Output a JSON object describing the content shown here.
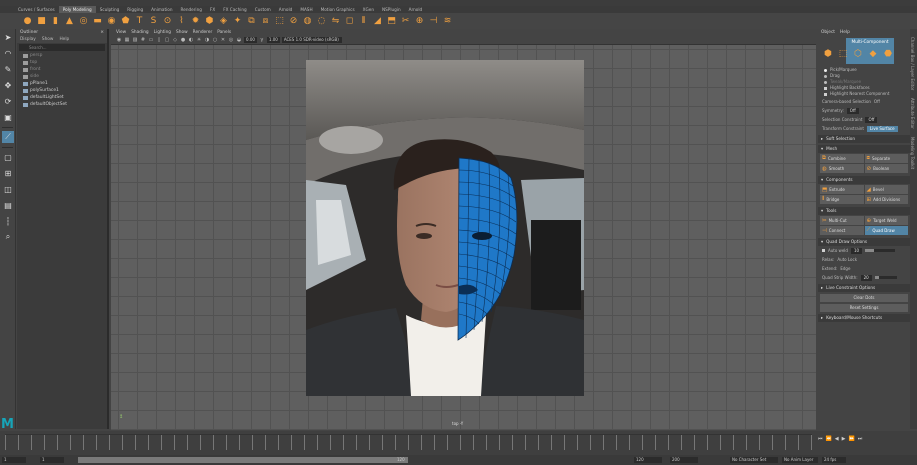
{
  "shelf": {
    "tabs": [
      "Curves / Surfaces",
      "Poly Modeling",
      "Sculpting",
      "Rigging",
      "Animation",
      "Rendering",
      "FX",
      "FX Caching",
      "Custom",
      "Arnold",
      "MASH",
      "Motion Graphics",
      "XGen",
      "NSPlugin",
      "Arnold"
    ],
    "active_tab": "Poly Modeling",
    "icons": [
      "sphere",
      "cube",
      "cylinder",
      "cone",
      "torus",
      "plane",
      "disc",
      "platonic",
      "text",
      "svg",
      "pipe",
      "helix",
      "gear",
      "soccer",
      "superellipse",
      "sphere-tool",
      "combine",
      "separate",
      "extract",
      "booleans",
      "smooth",
      "average",
      "mirror",
      "fill-hole",
      "bridge",
      "bevel",
      "extrude",
      "multicut",
      "target-weld",
      "connect",
      "edge-flow"
    ]
  },
  "outliner": {
    "title": "Outliner",
    "menu": [
      "Display",
      "Show",
      "Help"
    ],
    "search_placeholder": "Search...",
    "items": [
      {
        "label": "persp",
        "kind": "cam",
        "dim": true
      },
      {
        "label": "top",
        "kind": "cam",
        "dim": true
      },
      {
        "label": "front",
        "kind": "cam",
        "dim": true
      },
      {
        "label": "side",
        "kind": "cam",
        "dim": true
      },
      {
        "label": "pPlane1",
        "kind": "mesh",
        "dim": false
      },
      {
        "label": "polySurface1",
        "kind": "mesh",
        "dim": false
      },
      {
        "label": "defaultLightSet",
        "kind": "set",
        "dim": false
      },
      {
        "label": "defaultObjectSet",
        "kind": "set",
        "dim": false
      }
    ]
  },
  "viewport": {
    "menu": [
      "View",
      "Shading",
      "Lighting",
      "Show",
      "Renderer",
      "Panels"
    ],
    "exposure": "0.00",
    "gamma": "1.00",
    "colorspace": "ACES 1.0 SDR-video (sRGB)",
    "camera_label": "top -Y"
  },
  "toolkit": {
    "menu": [
      "Object",
      "Help"
    ],
    "mode_label": "Multi-Component",
    "selection_options": [
      {
        "label": "Pick/Marquee",
        "type": "radio",
        "on": true,
        "dim": false
      },
      {
        "label": "Drag",
        "type": "radio",
        "on": false,
        "dim": false
      },
      {
        "label": "Tweak/Marquee",
        "type": "radio",
        "on": false,
        "dim": true
      },
      {
        "label": "Highlight Backfaces",
        "type": "check",
        "on": true,
        "dim": false
      },
      {
        "label": "Highlight Nearest Component",
        "type": "check",
        "on": true,
        "dim": false
      }
    ],
    "camera_based_label": "Camera-based Selection",
    "camera_based_value": "Off",
    "symmetry_label": "Symmetry:",
    "symmetry_value": "Off",
    "selection_constraint_label": "Selection Constraint",
    "selection_constraint_value": "Off",
    "transform_constraint_label": "Transform Constraint",
    "transform_constraint_value": "Live Surface",
    "soft_selection": "Soft Selection",
    "mesh_header": "Mesh",
    "mesh_buttons": [
      "Combine",
      "Separate",
      "Smooth",
      "Boolean"
    ],
    "components_header": "Components",
    "components_buttons": [
      "Extrude",
      "Bevel",
      "Bridge",
      "Add Divisions"
    ],
    "tools_header": "Tools",
    "tools_buttons": [
      "Multi-Cut",
      "Target Weld",
      "Connect",
      "Quad Draw"
    ],
    "active_tool": "Quad Draw",
    "quad_draw_header": "Quad Draw Options",
    "auto_weld_label": "Auto weld",
    "auto_weld_value": "10",
    "relax_label": "Relax:",
    "relax_value": "Auto Lock",
    "extend_label": "Extend:",
    "extend_value": "Edge",
    "quad_strip_label": "Quad Strip Width:",
    "quad_strip_value": "20",
    "live_constraint": "Live Constraint Options",
    "clear_dots": "Clear Dots",
    "reset_settings": "Reset Settings",
    "shortcuts": "Keyboard/Mouse Shortcuts"
  },
  "side_tabs": [
    "Channel Box / Layer Editor",
    "Attribute Editor",
    "Modeling Toolkit"
  ],
  "timeline": {
    "start": "1",
    "current": "1",
    "range_start": "1",
    "range_end": "120",
    "end": "120",
    "anim_end": "200",
    "character_set": "No Character Set",
    "anim_layer": "No Anim Layer",
    "fps": "24 fps"
  },
  "colors": {
    "accent": "#5285a6",
    "icon_orange": "#f0a040",
    "quad_mesh": "#1f78c8",
    "maya_logo": "#17a4b8"
  }
}
